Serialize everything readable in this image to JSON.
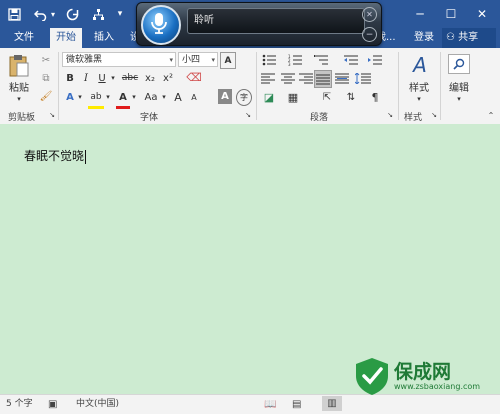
{
  "quick_access": {
    "save": "save-icon",
    "undo": "undo-icon",
    "redo": "redo-icon",
    "tree": "org-icon"
  },
  "speech": {
    "status": "聆听"
  },
  "window": {
    "minimize": "─",
    "restore": "☐",
    "close": "✕"
  },
  "tabs": [
    {
      "label": "文件"
    },
    {
      "label": "开始"
    },
    {
      "label": "插入"
    },
    {
      "label": "设"
    }
  ],
  "tabs_right": {
    "hint": "我...",
    "login": "登录",
    "share": "共享"
  },
  "clipboard": {
    "paste": "粘贴",
    "group": "剪贴板"
  },
  "font": {
    "name": "微软雅黑",
    "size": "小四",
    "group": "字体",
    "bold": "B",
    "italic": "I",
    "underline": "U",
    "strike": "abc",
    "sub": "x₂",
    "sup": "x²",
    "case": "Aa",
    "grow": "A",
    "shrink": "A",
    "clear": "A",
    "highlight": "ab",
    "color": "A",
    "boxA": "A"
  },
  "paragraph": {
    "group": "段落"
  },
  "styles": {
    "label": "样式",
    "group": "样式"
  },
  "editing": {
    "label": "编辑"
  },
  "document": {
    "text": "春眠不觉晓"
  },
  "status": {
    "words": "5 个字",
    "language": "中文(中国)"
  },
  "watermark": {
    "title": "保成网",
    "url": "www.zsbaoxiang.com"
  },
  "colors": {
    "brand": "#2b579a",
    "doc_bg": "#cdebd1",
    "ribbon": "#f3f3f3",
    "logo_green": "#2a9b45"
  }
}
